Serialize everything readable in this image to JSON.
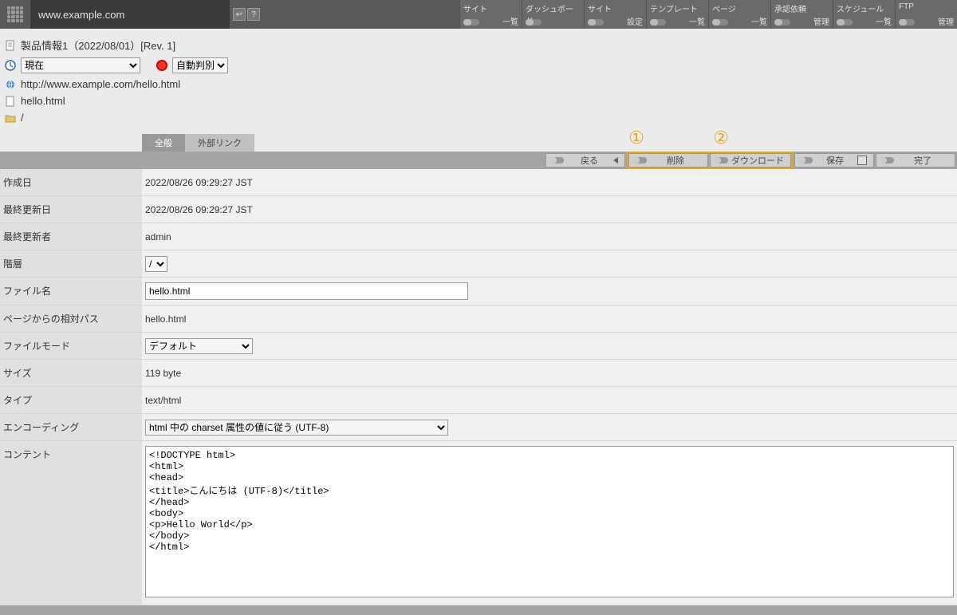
{
  "top": {
    "domain": "www.example.com",
    "nav": [
      {
        "top": "サイト",
        "bottom": "一覧"
      },
      {
        "top": "ダッシュボード",
        "bottom": ""
      },
      {
        "top": "サイト",
        "bottom": "設定"
      },
      {
        "top": "テンプレート",
        "bottom": "一覧"
      },
      {
        "top": "ページ",
        "bottom": "一覧"
      },
      {
        "top": "承認依頼",
        "bottom": "管理"
      },
      {
        "top": "スケジュール",
        "bottom": "一覧"
      },
      {
        "top": "FTP",
        "bottom": "管理"
      }
    ]
  },
  "header": {
    "title": "製品情報1（2022/08/01）[Rev. 1]",
    "time_select": "現在",
    "auto_select": "自動判別",
    "url": "http://www.example.com/hello.html",
    "filename": "hello.html",
    "path": "/"
  },
  "tabs": {
    "active": "全般",
    "inactive": "外部リンク"
  },
  "actions": {
    "back": "戻る",
    "delete": "削除",
    "download": "ダウンロード",
    "save": "保存",
    "complete": "完了"
  },
  "annotations": {
    "one": "①",
    "two": "②"
  },
  "form": {
    "created_label": "作成日",
    "created_value": "2022/08/26 09:29:27 JST",
    "updated_label": "最終更新日",
    "updated_value": "2022/08/26 09:29:27 JST",
    "updater_label": "最終更新者",
    "updater_value": "admin",
    "hierarchy_label": "階層",
    "hierarchy_value": "/",
    "filename_label": "ファイル名",
    "filename_value": "hello.html",
    "relpath_label": "ページからの相対パス",
    "relpath_value": "hello.html",
    "filemode_label": "ファイルモード",
    "filemode_value": "デフォルト",
    "size_label": "サイズ",
    "size_value": "119 byte",
    "type_label": "タイプ",
    "type_value": "text/html",
    "encoding_label": "エンコーディング",
    "encoding_value": "html 中の charset 属性の値に従う (UTF-8)",
    "content_label": "コンテント",
    "content_value": "<!DOCTYPE html>\n<html>\n<head>\n<title>こんにちは (UTF-8)</title>\n</head>\n<body>\n<p>Hello World</p>\n</body>\n</html>"
  }
}
